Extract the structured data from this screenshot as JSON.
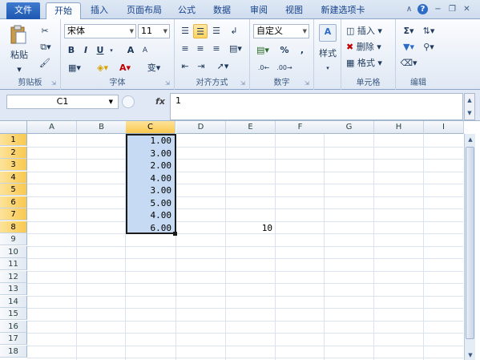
{
  "ribbon_tabs": [
    "文件",
    "开始",
    "插入",
    "页面布局",
    "公式",
    "数据",
    "审阅",
    "视图",
    "新建选项卡"
  ],
  "clipboard": {
    "paste": "粘贴",
    "label": "剪贴板"
  },
  "font": {
    "name": "宋体",
    "size": "11",
    "bold": "B",
    "italic": "I",
    "underline": "U",
    "grow": "A",
    "shrink": "A",
    "label": "字体",
    "font_color": "A",
    "phonetic": "变"
  },
  "alignment": {
    "label": "对齐方式"
  },
  "number": {
    "format": "自定义",
    "percent": "%",
    "comma": ",",
    "label": "数字"
  },
  "styles": {
    "label": "样式"
  },
  "cells": {
    "insert": "插入",
    "delete": "删除",
    "format": "格式",
    "label": "单元格"
  },
  "editing": {
    "sum": "Σ",
    "label": "编辑"
  },
  "formula_bar": {
    "name_box": "C1",
    "fx": "fx",
    "value": "1"
  },
  "columns": [
    "A",
    "B",
    "C",
    "D",
    "E",
    "F",
    "G",
    "H",
    "I"
  ],
  "selected_column": "C",
  "rows": [
    "1",
    "2",
    "3",
    "4",
    "5",
    "6",
    "7",
    "8",
    "9",
    "10",
    "11",
    "12",
    "13",
    "14",
    "15",
    "16",
    "17",
    "18"
  ],
  "selected_rows": [
    "1",
    "2",
    "3",
    "4",
    "5",
    "6",
    "7",
    "8"
  ],
  "column_c_values": [
    "1.00",
    "3.00",
    "2.00",
    "4.00",
    "3.00",
    "5.00",
    "4.00",
    "6.00"
  ],
  "cell_e8": "10",
  "colors": {
    "selection_fill": "#c6dbf3",
    "header_highlight": "#f9c84f",
    "file_tab": "#1d57b0"
  }
}
